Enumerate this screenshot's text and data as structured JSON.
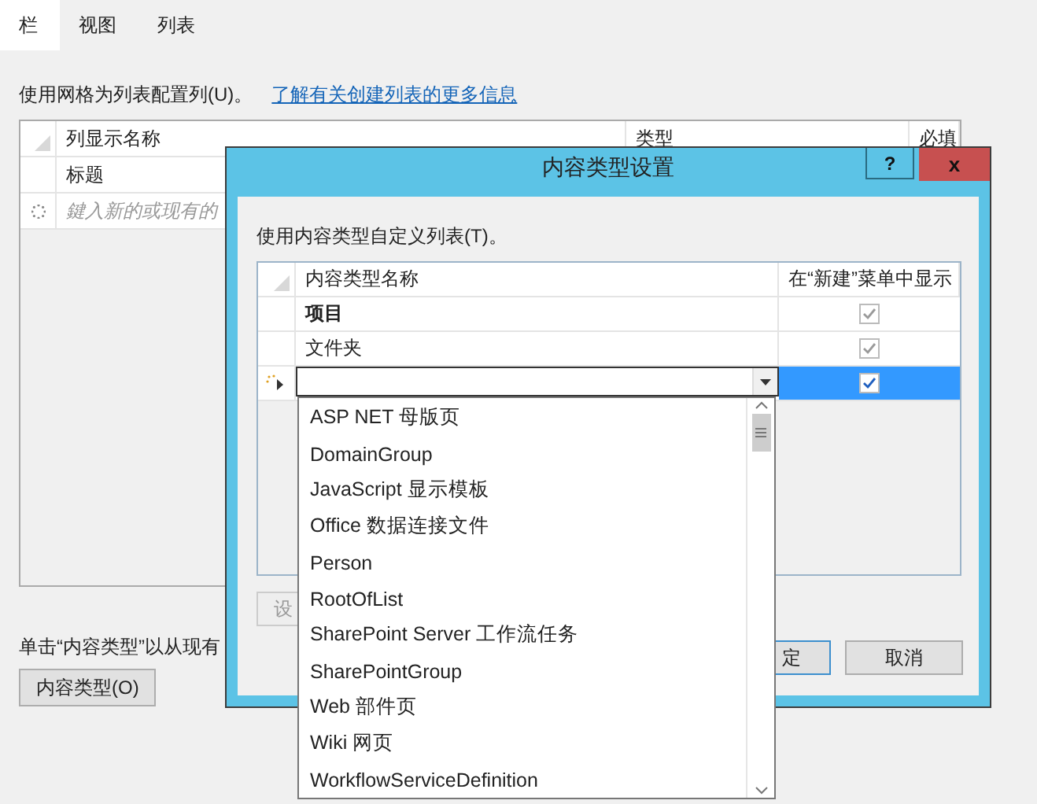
{
  "tabs": [
    {
      "label": "栏",
      "selected": true
    },
    {
      "label": "视图",
      "selected": false
    },
    {
      "label": "列表",
      "selected": false
    }
  ],
  "columns_page": {
    "instruction": "使用网格为列表配置列(U)。",
    "link": "了解有关创建列表的更多信息",
    "grid": {
      "columns": [
        "列显示名称",
        "类型",
        "必填"
      ],
      "rows": [
        {
          "name": "标题"
        }
      ],
      "new_row_placeholder": "鍵入新的或现有的"
    },
    "hint": "单击“内容类型”以从现有",
    "content_types_button": "内容类型(O)"
  },
  "dialog": {
    "title": "内容类型设置",
    "help_button": "?",
    "close_button": "x",
    "instruction": "使用内容类型自定义列表(T)。",
    "grid": {
      "columns": [
        "内容类型名称",
        "在“新建”菜单中显示"
      ],
      "rows": [
        {
          "name": "项目",
          "bold": true,
          "show_in_new": true
        },
        {
          "name": "文件夹",
          "bold": false,
          "show_in_new": true
        }
      ],
      "new_row": {
        "selected": true,
        "show_in_new": true
      }
    },
    "settings_button": "设",
    "ok_button": "定",
    "cancel_button": "取消"
  },
  "dropdown": {
    "expanded": true,
    "items": [
      "ASP NET 母版页",
      "DomainGroup",
      "JavaScript 显示模板",
      "Office 数据连接文件",
      "Person",
      "RootOfList",
      "SharePoint Server 工作流任务",
      "SharePointGroup",
      "Web 部件页",
      "Wiki 网页",
      "WorkflowServiceDefinition"
    ]
  }
}
